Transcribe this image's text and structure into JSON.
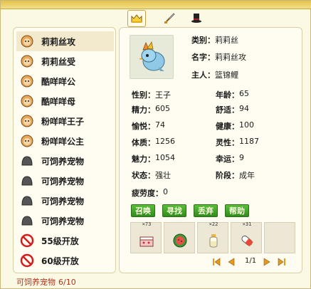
{
  "tabs": [
    {
      "name": "crown",
      "active": true
    },
    {
      "name": "sword",
      "active": false
    },
    {
      "name": "top-hat",
      "active": false
    }
  ],
  "pet_list": [
    {
      "label": "莉莉丝攻",
      "icon": "pet-head-icon"
    },
    {
      "label": "莉莉丝受",
      "icon": "pet-head-icon"
    },
    {
      "label": "酷咩咩公",
      "icon": "pet-head-icon"
    },
    {
      "label": "酷咩咩母",
      "icon": "pet-head-icon"
    },
    {
      "label": "粉咩咩王子",
      "icon": "pet-head-icon"
    },
    {
      "label": "粉咩咩公主",
      "icon": "pet-head-icon"
    },
    {
      "label": "可饲养宠物",
      "icon": "empty-slot-icon"
    },
    {
      "label": "可饲养宠物",
      "icon": "empty-slot-icon"
    },
    {
      "label": "可饲养宠物",
      "icon": "empty-slot-icon"
    },
    {
      "label": "可饲养宠物",
      "icon": "empty-slot-icon"
    },
    {
      "label": "55级开放",
      "icon": "locked-icon"
    },
    {
      "label": "60级开放",
      "icon": "locked-icon"
    }
  ],
  "footer": {
    "label": "可饲养宠物",
    "count": "6/10"
  },
  "pet": {
    "category_label": "类别：",
    "category": "莉莉丝",
    "name_label": "名字：",
    "name": "莉莉丝攻",
    "owner_label": "主人：",
    "owner": "篮锦鲤",
    "gender_label": "性别：",
    "gender": "王子",
    "age_label": "年龄：",
    "age": "65",
    "energy_label": "精力：",
    "energy": "605",
    "comfort_label": "舒适：",
    "comfort": "94",
    "joy_label": "愉悦：",
    "joy": "74",
    "health_label": "健康：",
    "health": "100",
    "physique_label": "体质：",
    "physique": "1256",
    "spirit_label": "灵性：",
    "spirit": "1187",
    "charm_label": "魅力：",
    "charm": "1054",
    "luck_label": "幸运：",
    "luck": "9",
    "state_label": "状态：",
    "state": "强壮",
    "stage_label": "阶段：",
    "stage": "成年",
    "fatigue_label": "疲劳度：",
    "fatigue": "0"
  },
  "actions": {
    "summon": "召唤",
    "find": "寻找",
    "discard": "丢弃",
    "help": "帮助"
  },
  "items": [
    {
      "count": "×73",
      "icon": "cake-icon"
    },
    {
      "count": "",
      "icon": "watermelon-icon"
    },
    {
      "count": "×22",
      "icon": "milk-bottle-icon"
    },
    {
      "count": "×31",
      "icon": "pill-icon"
    },
    {
      "count": "",
      "icon": "empty-icon"
    }
  ],
  "pager": {
    "text": "1/1"
  }
}
